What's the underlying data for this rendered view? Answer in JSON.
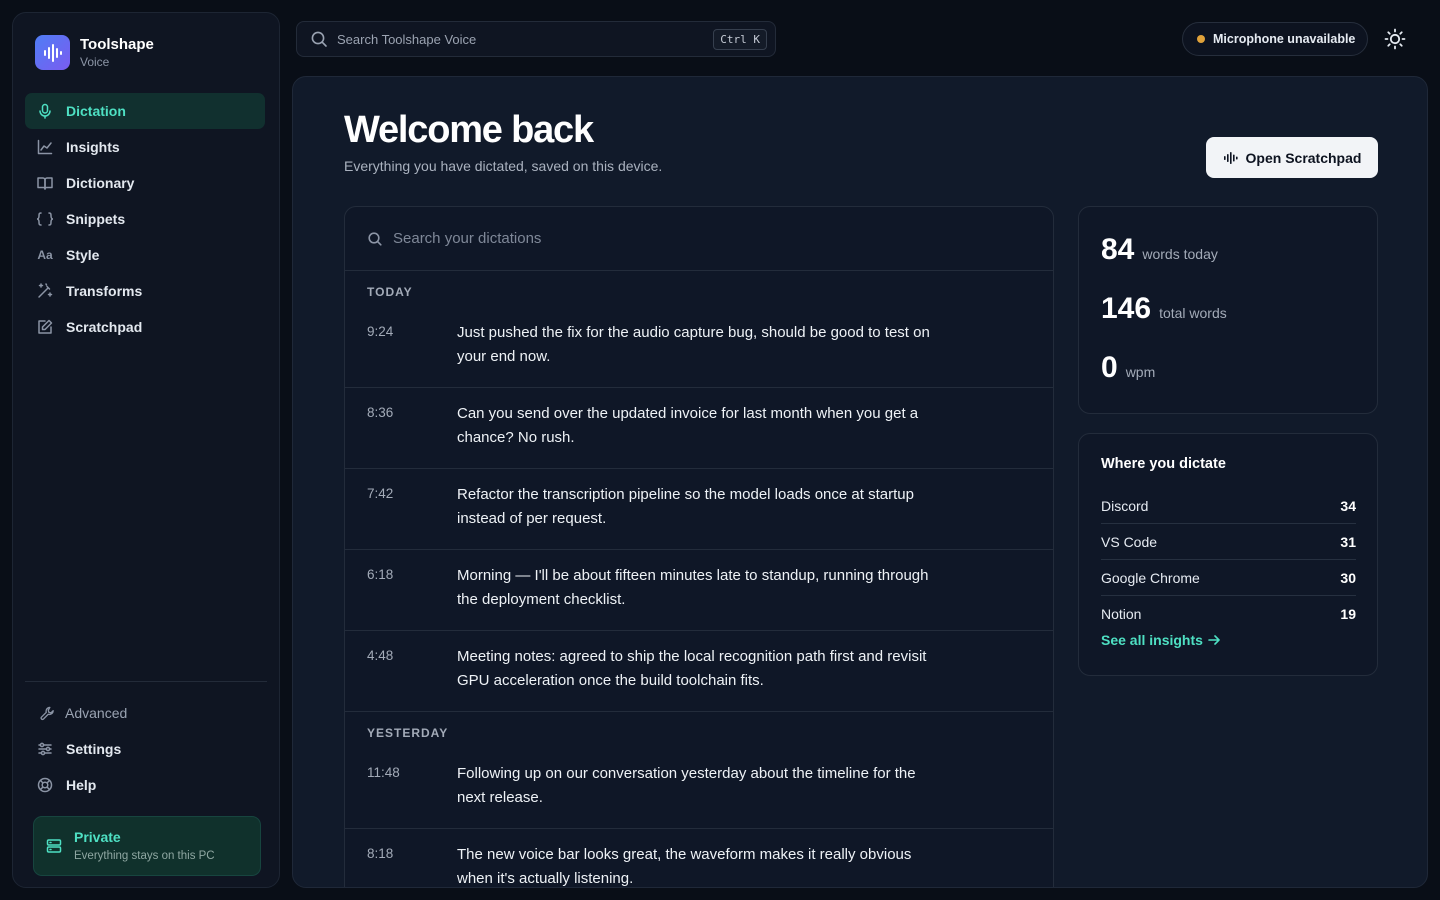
{
  "brand": {
    "name": "Toolshape",
    "subtitle": "Voice"
  },
  "nav": {
    "items": [
      {
        "label": "Dictation",
        "icon": "microphone-icon",
        "active": true
      },
      {
        "label": "Insights",
        "icon": "chart-line-icon"
      },
      {
        "label": "Dictionary",
        "icon": "book-icon"
      },
      {
        "label": "Snippets",
        "icon": "braces-icon"
      },
      {
        "label": "Style",
        "icon": "type-icon"
      },
      {
        "label": "Transforms",
        "icon": "wand-icon"
      },
      {
        "label": "Scratchpad",
        "icon": "edit-square-icon"
      }
    ],
    "bottom": [
      {
        "label": "Advanced",
        "icon": "wrench-icon"
      },
      {
        "label": "Settings",
        "icon": "sliders-icon"
      },
      {
        "label": "Help",
        "icon": "lifebuoy-icon"
      }
    ]
  },
  "private_card": {
    "title": "Private",
    "subtitle": "Everything stays on this PC"
  },
  "topbar": {
    "search_placeholder": "Search Toolshape Voice",
    "shortcut": "Ctrl K",
    "mic_status": "Microphone unavailable",
    "mic_status_color": "#e0a23a"
  },
  "main": {
    "title": "Welcome back",
    "subtitle": "Everything you have dictated, saved on this device.",
    "open_button": "Open Scratchpad"
  },
  "feed": {
    "search_placeholder": "Search your dictations",
    "groups": [
      {
        "label": "TODAY",
        "entries": [
          {
            "time": "9:24",
            "text": "Just pushed the fix for the audio capture bug, should be good to test on your end now."
          },
          {
            "time": "8:36",
            "text": "Can you send over the updated invoice for last month when you get a chance? No rush."
          },
          {
            "time": "7:42",
            "text": "Refactor the transcription pipeline so the model loads once at startup instead of per request."
          },
          {
            "time": "6:18",
            "text": "Morning — I'll be about fifteen minutes late to standup, running through the deployment checklist."
          },
          {
            "time": "4:48",
            "text": "Meeting notes: agreed to ship the local recognition path first and revisit GPU acceleration once the build toolchain fits."
          }
        ]
      },
      {
        "label": "YESTERDAY",
        "entries": [
          {
            "time": "11:48",
            "text": "Following up on our conversation yesterday about the timeline for the next release."
          },
          {
            "time": "8:18",
            "text": "The new voice bar looks great, the waveform makes it really obvious when it's actually listening."
          }
        ]
      }
    ]
  },
  "stats": [
    {
      "value": "84",
      "unit": "words today"
    },
    {
      "value": "146",
      "unit": "total words"
    },
    {
      "value": "0",
      "unit": "wpm"
    }
  ],
  "apps": {
    "title": "Where you dictate",
    "items": [
      {
        "name": "Discord",
        "count": "34"
      },
      {
        "name": "VS Code",
        "count": "31"
      },
      {
        "name": "Google Chrome",
        "count": "30"
      },
      {
        "name": "Notion",
        "count": "19"
      }
    ],
    "link": "See all insights"
  },
  "colors": {
    "accent": "#4ee0c3",
    "background": "#090e17",
    "panel": "#111a2a",
    "card": "#0f1727"
  }
}
